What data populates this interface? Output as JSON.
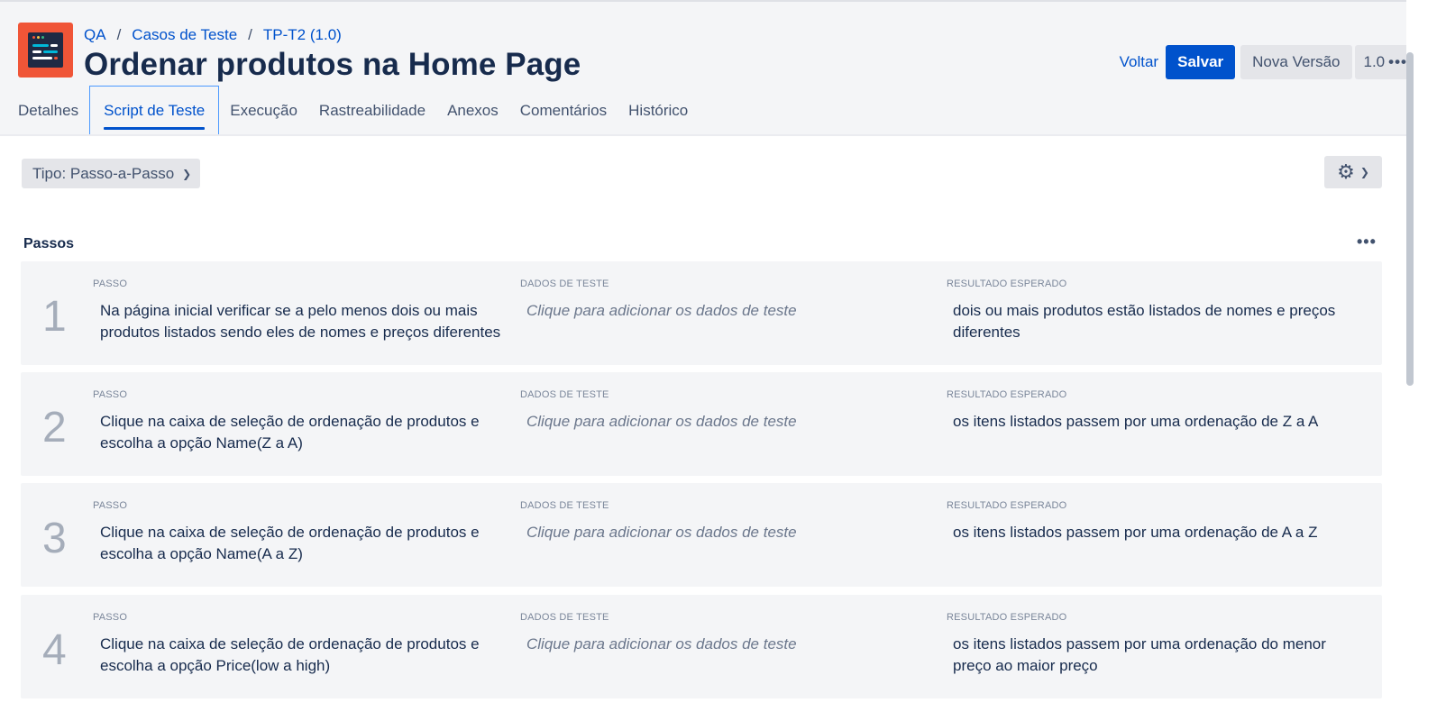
{
  "breadcrumb": {
    "project": "QA",
    "folder": "Casos de Teste",
    "item": "TP-T2 (1.0)"
  },
  "page_title": "Ordenar produtos na Home Page",
  "actions": {
    "back": "Voltar",
    "save": "Salvar",
    "new_version": "Nova Versão",
    "version": "1.0",
    "more": "•••"
  },
  "tabs": [
    {
      "label": "Detalhes"
    },
    {
      "label": "Script de Teste"
    },
    {
      "label": "Execução"
    },
    {
      "label": "Rastreabilidade"
    },
    {
      "label": "Anexos"
    },
    {
      "label": "Comentários"
    },
    {
      "label": "Histórico"
    }
  ],
  "active_tab": "Script de Teste",
  "type_select": {
    "value": "Tipo: Passo-a-Passo"
  },
  "section": {
    "title": "Passos",
    "more": "•••"
  },
  "columns": {
    "step": "PASSO",
    "data": "DADOS DE TESTE",
    "result": "RESULTADO ESPERADO"
  },
  "steps": [
    {
      "number": "1",
      "step": "Na página inicial verificar se a pelo menos dois ou mais produtos listados sendo eles de nomes e preços diferentes",
      "data": "Clique para adicionar os dados de teste",
      "result": "dois ou mais produtos estão listados de nomes e preços diferentes"
    },
    {
      "number": "2",
      "step": "Clique na caixa de seleção de ordenação de produtos e escolha a opção Name(Z a A)",
      "data": "Clique para adicionar os dados de teste",
      "result": "os itens listados passem por uma ordenação de Z a A"
    },
    {
      "number": "3",
      "step": "Clique na caixa de seleção de ordenação de produtos e escolha a opção Name(A a Z)",
      "data": "Clique para adicionar os dados de teste",
      "result": "os itens listados passem por uma ordenação de A a Z"
    },
    {
      "number": "4",
      "step": "Clique na caixa de seleção de ordenação de produtos e escolha a opção Price(low a high)",
      "data": "Clique para adicionar os dados de teste",
      "result": "os itens listados passem por uma ordenação do menor preço ao maior preço"
    }
  ],
  "colors": {
    "accent": "#0052cc",
    "logo": "#f05537",
    "title": "#172b4d",
    "card_bg": "#f4f5f7"
  },
  "icons": {
    "gear": "gear-icon",
    "chevron": "chevron-down-icon",
    "logo": "app-logo-icon"
  }
}
